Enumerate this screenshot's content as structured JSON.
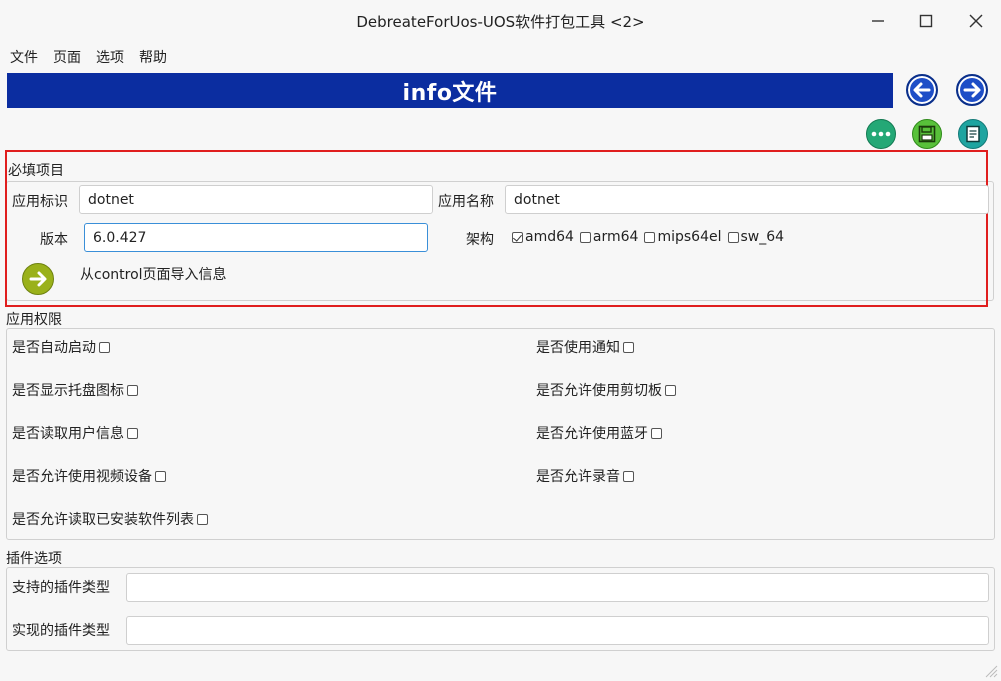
{
  "window": {
    "title": "DebreateForUos-UOS软件打包工具 <2>"
  },
  "menu": [
    "文件",
    "页面",
    "选项",
    "帮助"
  ],
  "banner": {
    "title": "info文件"
  },
  "required": {
    "section_title": "必填项目",
    "app_id_label": "应用标识",
    "app_id_value": "dotnet",
    "app_name_label": "应用名称",
    "app_name_value": "dotnet",
    "version_label": "版本",
    "version_value": "6.0.427",
    "arch_label": "架构",
    "arch_options": [
      {
        "label": "amd64",
        "checked": true
      },
      {
        "label": "arm64",
        "checked": false
      },
      {
        "label": "mips64el",
        "checked": false
      },
      {
        "label": "sw_64",
        "checked": false
      }
    ],
    "import_label": "从control页面导入信息"
  },
  "permissions": {
    "section_title": "应用权限",
    "items": [
      {
        "label": "是否自动启动",
        "checked": false
      },
      {
        "label": "是否使用通知",
        "checked": false
      },
      {
        "label": "是否显示托盘图标",
        "checked": false
      },
      {
        "label": "是否允许使用剪切板",
        "checked": false
      },
      {
        "label": "是否读取用户信息",
        "checked": false
      },
      {
        "label": "是否允许使用蓝牙",
        "checked": false
      },
      {
        "label": "是否允许使用视频设备",
        "checked": false
      },
      {
        "label": "是否允许录音",
        "checked": false
      },
      {
        "label": "是否允许读取已安装软件列表",
        "checked": false
      }
    ]
  },
  "plugins": {
    "section_title": "插件选项",
    "supported_label": "支持的插件类型",
    "supported_value": "",
    "implemented_label": "实现的插件类型",
    "implemented_value": ""
  },
  "colors": {
    "banner": "#0b2da0",
    "nav_button": "#1e4ec7",
    "highlight_frame": "#e01e1e"
  }
}
